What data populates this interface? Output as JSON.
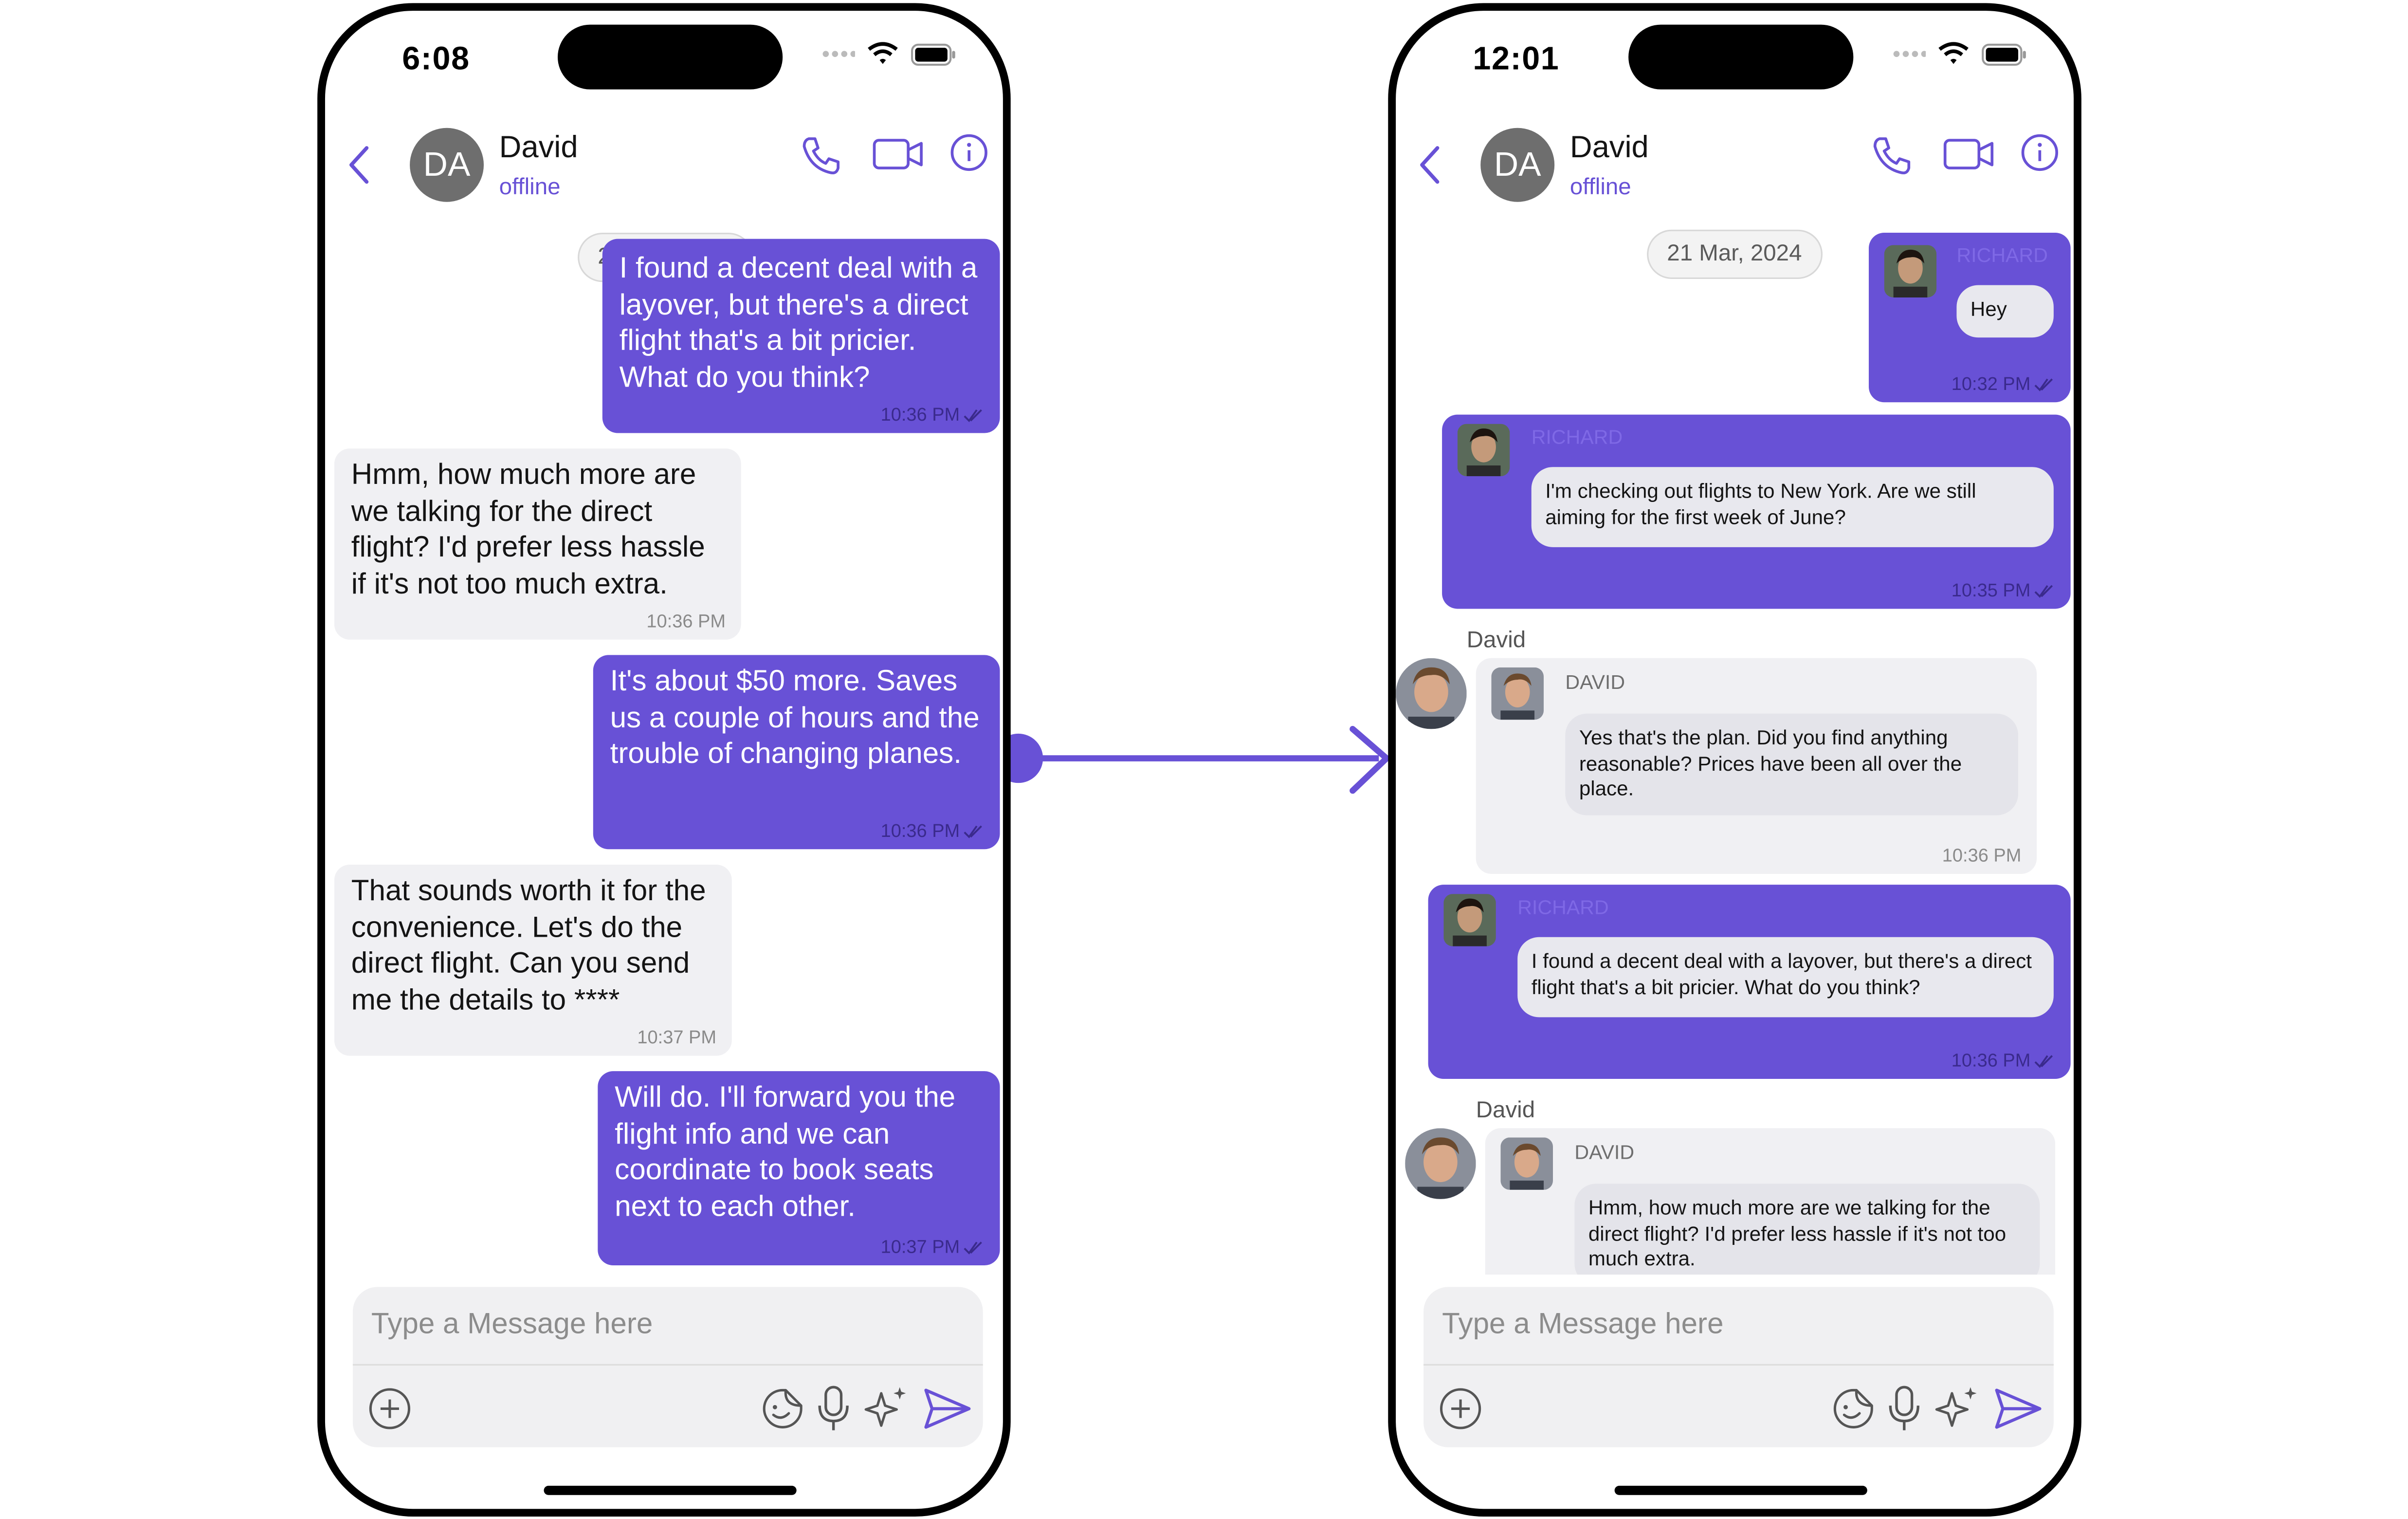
{
  "left_phone": {
    "status": {
      "time": "6:08"
    },
    "header": {
      "avatar_initials": "DA",
      "name": "David",
      "status": "offline"
    },
    "date_separator": "21 Mar, 2024",
    "messages": [
      {
        "direction": "out",
        "text": "I found a decent deal with a layover, but there's a direct flight that's a bit pricier. What do you think?",
        "time": "10:36 PM"
      },
      {
        "direction": "in",
        "text": "Hmm, how much more are we talking for the direct flight? I'd prefer less hassle if it's not too much extra.",
        "time": "10:36 PM"
      },
      {
        "direction": "out",
        "text": "It's about $50 more. Saves us a couple of hours and the trouble of changing planes.",
        "time": "10:36 PM"
      },
      {
        "direction": "in",
        "text": "That sounds worth it for the convenience. Let's do the direct flight. Can you send me the details to ****",
        "time": "10:37 PM"
      },
      {
        "direction": "out",
        "text": "Will do. I'll forward you the flight info and we can coordinate to book seats next to each other.",
        "time": "10:37 PM"
      }
    ],
    "composer": {
      "placeholder": "Type a Message here"
    }
  },
  "right_phone": {
    "status": {
      "time": "12:01"
    },
    "header": {
      "avatar_initials": "DA",
      "name": "David",
      "status": "offline"
    },
    "date_separator": "21 Mar, 2024",
    "messages": [
      {
        "direction": "out",
        "sender_label": "RICHARD",
        "text": "Hey",
        "time": "10:32 PM"
      },
      {
        "direction": "out",
        "sender_label": "RICHARD",
        "text": "I'm checking out flights to New York. Are we still aiming for the first week of June?",
        "time": "10:35 PM"
      },
      {
        "direction": "in",
        "group_name": "David",
        "sender_label": "DAVID",
        "text": "Yes that's the plan. Did you find anything reasonable? Prices have been all over the place.",
        "time": "10:36 PM"
      },
      {
        "direction": "out",
        "sender_label": "RICHARD",
        "text": "I found a decent deal with a layover, but there's a direct flight that's a bit pricier. What do you think?",
        "time": "10:36 PM"
      },
      {
        "direction": "in",
        "group_name": "David",
        "sender_label": "DAVID",
        "text": "Hmm, how much more are we talking for the direct flight? I'd prefer less hassle if it's not too much extra.",
        "time": ""
      }
    ],
    "composer": {
      "placeholder": "Type a Message here"
    }
  },
  "colors": {
    "accent": "#6851d6",
    "incoming_bubble": "#f0f0f3",
    "composer_bg": "#f0f0f2"
  },
  "icons": [
    "back-chevron-icon",
    "voice-call-icon",
    "video-call-icon",
    "info-icon",
    "add-attachment-icon",
    "sticker-icon",
    "microphone-icon",
    "ai-sparkle-icon",
    "send-icon",
    "read-receipt-icon",
    "wifi-icon",
    "battery-icon",
    "signal-icon"
  ]
}
